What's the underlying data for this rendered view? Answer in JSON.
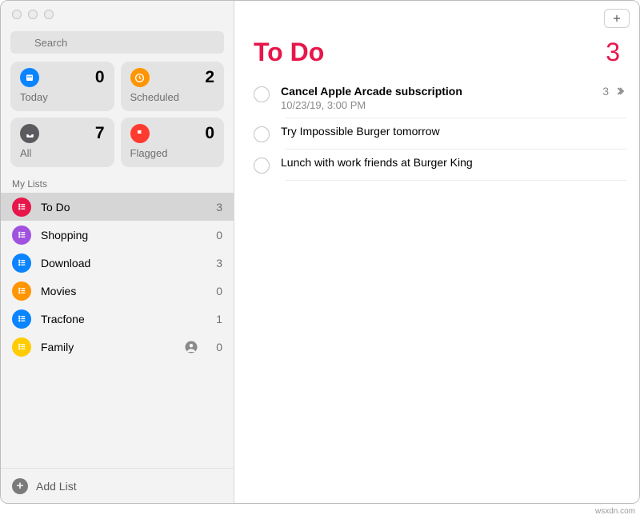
{
  "search": {
    "placeholder": "Search"
  },
  "cards": {
    "today": {
      "label": "Today",
      "count": 0
    },
    "scheduled": {
      "label": "Scheduled",
      "count": 2
    },
    "all": {
      "label": "All",
      "count": 7
    },
    "flagged": {
      "label": "Flagged",
      "count": 0
    }
  },
  "lists_header": "My Lists",
  "lists": [
    {
      "name": "To Do",
      "count": 3,
      "color": "#e6174b",
      "selected": true,
      "shared": false
    },
    {
      "name": "Shopping",
      "count": 0,
      "color": "#a052de",
      "selected": false,
      "shared": false
    },
    {
      "name": "Download",
      "count": 3,
      "color": "#0a84ff",
      "selected": false,
      "shared": false
    },
    {
      "name": "Movies",
      "count": 0,
      "color": "#ff9500",
      "selected": false,
      "shared": false
    },
    {
      "name": "Tracfone",
      "count": 1,
      "color": "#0a84ff",
      "selected": false,
      "shared": false
    },
    {
      "name": "Family",
      "count": 0,
      "color": "#ffcc00",
      "selected": false,
      "shared": true
    }
  ],
  "add_list_label": "Add List",
  "main": {
    "title": "To Do",
    "title_color": "#e6174b",
    "count": 3,
    "reminders": [
      {
        "title": "Cancel Apple Arcade subscription",
        "subtitle": "10/23/19, 3:00 PM",
        "subtasks": 3,
        "bold": true
      },
      {
        "title": "Try Impossible Burger tomorrow"
      },
      {
        "title": "Lunch with work friends at Burger King"
      }
    ]
  },
  "watermark": "wsxdn.com"
}
